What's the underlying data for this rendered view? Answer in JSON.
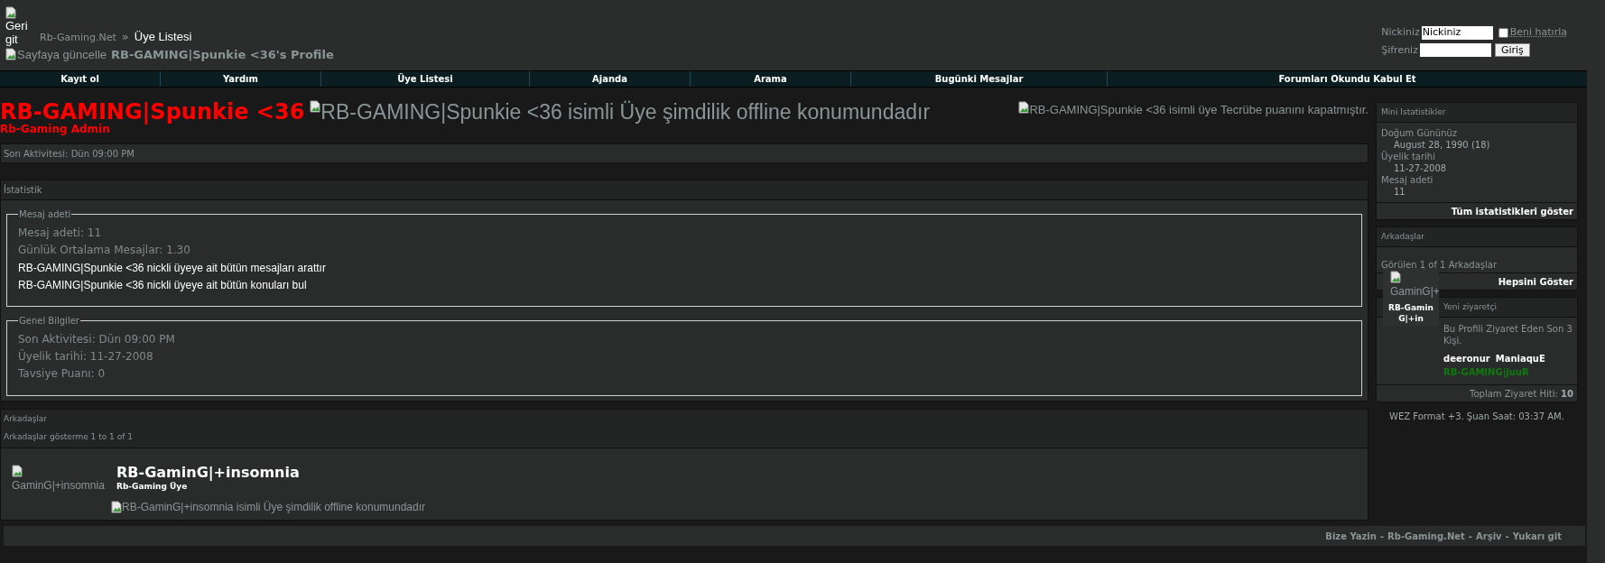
{
  "header": {
    "back_alt": "Geri git",
    "breadcrumb": {
      "site": "Rb-Gaming.Net",
      "separator": "»",
      "current": "Üye Listesi"
    },
    "refresh_alt": "Sayfaya güncelle",
    "profile_title": "RB-GAMING|Spunkie <36's Profile"
  },
  "login": {
    "nick_label": "Nickiniz",
    "nick_value": "Nickiniz",
    "remember_label": "Beni hatırla",
    "remember_checked": false,
    "password_label": "Şifreniz",
    "button": "Giriş"
  },
  "nav": [
    "Kayıt ol",
    "Yardım",
    "Üye Listesi",
    "Ajanda",
    "Arama",
    "Bugünki Mesajlar",
    "Forumları Okundu Kabul Et"
  ],
  "profile": {
    "username": "RB-GAMING|Spunkie <36",
    "usertitle": "Rb-Gaming Admin",
    "status_alt": "RB-GAMING|Spunkie <36 isimli Üye şimdilik offline konumundadır",
    "reputation_alt": "RB-GAMING|Spunkie <36 isimli üye Tecrübe puanını kapatmıştır.",
    "last_activity_label": "Son Aktivitesi:",
    "last_activity_value": "Dün 09:00 PM"
  },
  "stats": {
    "title": "İstatistik",
    "fieldsets": [
      {
        "legend": "Mesaj adeti",
        "rows": [
          {
            "kind": "pair",
            "label": "Mesaj adeti:",
            "value": "11"
          },
          {
            "kind": "pair",
            "label": "Günlük Ortalama Mesajlar:",
            "value": "1.30"
          },
          {
            "kind": "link",
            "text": "RB-GAMING|Spunkie <36 nickli üyeye ait bütün mesajları arattır"
          },
          {
            "kind": "link",
            "text": "RB-GAMING|Spunkie <36 nickli üyeye ait bütün konuları bul"
          }
        ]
      },
      {
        "legend": "Genel Bilgiler",
        "rows": [
          {
            "kind": "pair",
            "label": "Son Aktivitesi:",
            "value": "Dün 09:00 PM"
          },
          {
            "kind": "pair",
            "label": "Üyelik tarihi:",
            "value": "11-27-2008"
          },
          {
            "kind": "pair",
            "label": "Tavsiye Puanı:",
            "value": "0"
          }
        ]
      }
    ]
  },
  "friends": {
    "title": "Arkadaşlar",
    "subtitle": "Arkadaşlar gösterme 1 to 1 of 1",
    "items": [
      {
        "avatar_alt": "GaminG|+insomnia",
        "name": "RB-GaminG|+insomnia",
        "title": "Rb-Gaming Üye",
        "status_alt": "RB-GaminG|+insomnia isimli Üye şimdilik offline konumundadır"
      }
    ]
  },
  "sidebar": {
    "mini_stats": {
      "title": "Mini Istatistikler",
      "items": [
        {
          "label": "Doğum Gününüz",
          "value": "August 28, 1990 (18)"
        },
        {
          "label": "Üyelik tarihi",
          "value": "11-27-2008"
        },
        {
          "label": "Mesaj adeti",
          "value": "11"
        }
      ],
      "footer_link": "Tüm istatistikleri göster"
    },
    "friends": {
      "title": "Arkadaşlar",
      "text": "Görülen 1 of 1 Arkadaşlar",
      "footer_link": "Hepsini Göster",
      "popup": {
        "avatar_alt": "GaminG|+",
        "name": "RB-GaminG|+in"
      }
    },
    "visitors": {
      "title": "Yeni ziyaretçi",
      "text": "Bu Profili Ziyaret Eden Son 3 Kişi.",
      "items": [
        {
          "name": "deeronur",
          "color": "#ffffff"
        },
        {
          "name": "ManiaquE",
          "color": "#ffffff"
        },
        {
          "name": "RB-GAMING|juuR",
          "color": "#0f7a0f"
        }
      ],
      "total_label": "Toplam Ziyaret Hiti:",
      "total_value": "10"
    },
    "time_note": "WEZ Format +3. Şuan Saat: 03:37 AM."
  },
  "footer_links": [
    "Bize Yazin",
    "Rb-Gaming.Net",
    "Arşiv",
    "Yukarı git"
  ],
  "footer_separator": "-"
}
